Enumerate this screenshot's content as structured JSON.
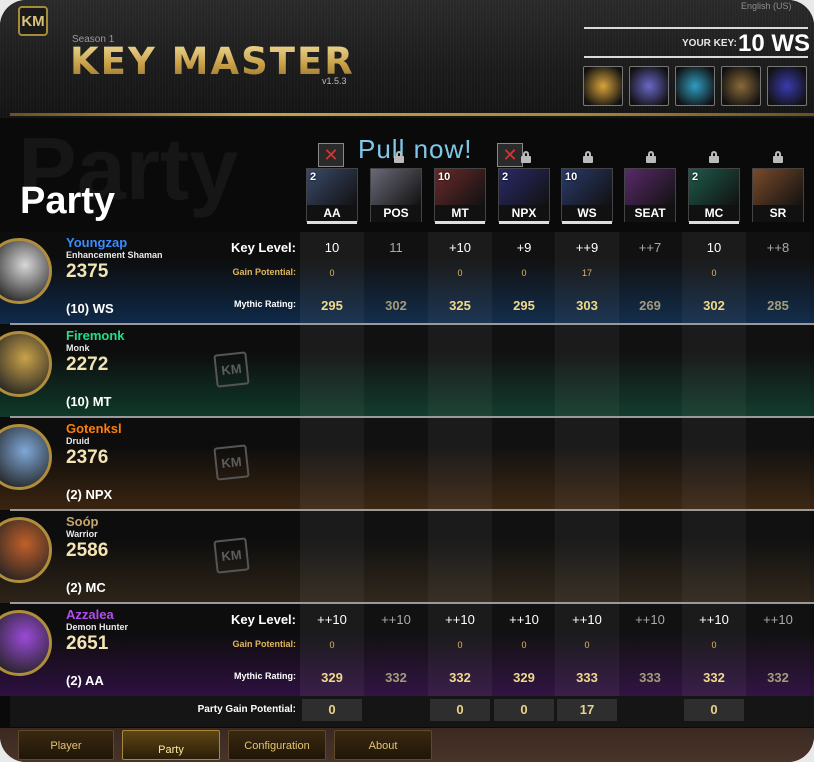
{
  "header": {
    "logo_badge": "KM",
    "language": "English (US)",
    "season": "Season 1",
    "title": "KEY MASTER",
    "version": "v1.5.3",
    "your_key_label": "YOUR KEY:",
    "your_key_value": "10 WS",
    "affixes": [
      {
        "icon": "affix-orb-icon",
        "color": "#d9a43a"
      },
      {
        "icon": "affix-swirl-icon",
        "color": "#6a68c8"
      },
      {
        "icon": "affix-silhouette-icon",
        "color": "#2f9ec2"
      },
      {
        "icon": "affix-mask-icon",
        "color": "#8a6a3a"
      },
      {
        "icon": "affix-spirit-icon",
        "color": "#3a3ab0"
      }
    ]
  },
  "party": {
    "heading": "Party",
    "pull_now": "Pull now!",
    "row_labels": {
      "key_level": "Key Level:",
      "gain_potential": "Gain Potential:",
      "mythic_rating": "Mythic Rating:"
    },
    "party_gain_label": "Party Gain Potential:"
  },
  "dungeons": [
    {
      "abbr": "AA",
      "level": "2",
      "color": "#3a4a6a"
    },
    {
      "abbr": "POS",
      "level": "",
      "color": "#6a6a78"
    },
    {
      "abbr": "MT",
      "level": "10",
      "color": "#6a2a2a"
    },
    {
      "abbr": "NPX",
      "level": "2",
      "color": "#2a2a6a"
    },
    {
      "abbr": "WS",
      "level": "10",
      "color": "#2a3a6a"
    },
    {
      "abbr": "SEAT",
      "level": "",
      "color": "#5a2a6a"
    },
    {
      "abbr": "MC",
      "level": "2",
      "color": "#1e5a4a"
    },
    {
      "abbr": "SR",
      "level": "",
      "color": "#7a4a2a"
    }
  ],
  "players": [
    {
      "name": "Youngzap",
      "name_color": "#3a8cff",
      "spec": "Enhancement Shaman",
      "rating": "2375",
      "key": "(10) WS",
      "bg": "#0f2a4a",
      "key_levels": [
        "10",
        "11",
        "+10",
        "+9",
        "++9",
        "++7",
        "10",
        "++8"
      ],
      "gain": [
        "0",
        "",
        "0",
        "0",
        "17",
        "",
        "0",
        ""
      ],
      "ratings": [
        "295",
        "302",
        "325",
        "295",
        "303",
        "269",
        "302",
        "285"
      ],
      "bright": [
        true,
        false,
        true,
        true,
        true,
        false,
        true,
        false
      ]
    },
    {
      "name": "Firemonk",
      "name_color": "#1fe08a",
      "spec": "Monk",
      "rating": "2272",
      "key": "(10) MT",
      "bg": "#0f3a2a"
    },
    {
      "name": "Gotenksl",
      "name_color": "#ff7d0a",
      "spec": "Druid",
      "rating": "2376",
      "key": "(2) NPX",
      "bg": "#3a2410"
    },
    {
      "name": "Soóp",
      "name_color": "#c8a46a",
      "spec": "Warrior",
      "rating": "2586",
      "key": "(2) MC",
      "bg": "#2e2418"
    },
    {
      "name": "Azzalea",
      "name_color": "#b44cf0",
      "spec": "Demon Hunter",
      "rating": "2651",
      "key": "(2) AA",
      "bg": "#2e1040",
      "key_levels": [
        "++10",
        "++10",
        "++10",
        "++10",
        "++10",
        "++10",
        "++10",
        "++10"
      ],
      "gain": [
        "0",
        "",
        "0",
        "0",
        "0",
        "",
        "0",
        ""
      ],
      "ratings": [
        "329",
        "332",
        "332",
        "329",
        "333",
        "333",
        "332",
        "332"
      ],
      "bright": [
        true,
        false,
        true,
        true,
        true,
        false,
        true,
        false
      ]
    }
  ],
  "party_gain": [
    "0",
    "",
    "0",
    "0",
    "17",
    "",
    "0",
    ""
  ],
  "tabs": [
    {
      "label": "Player",
      "active": false
    },
    {
      "label": "Party",
      "active": true
    },
    {
      "label": "Configuration",
      "active": false
    },
    {
      "label": "About",
      "active": false
    }
  ]
}
